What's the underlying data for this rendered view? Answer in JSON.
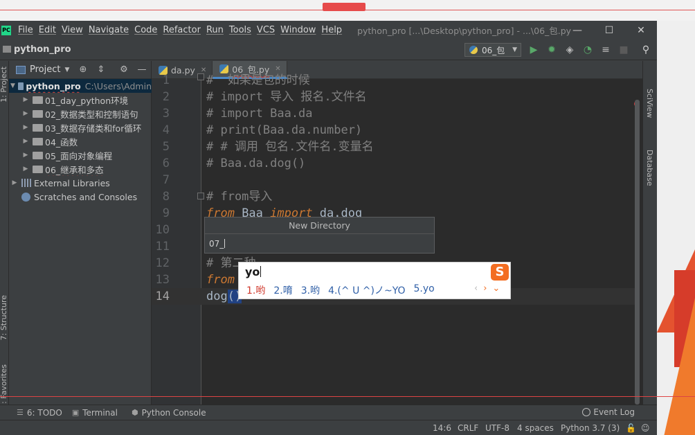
{
  "window": {
    "title": "python_pro [...\\Desktop\\python_pro] - ...\\06_包.py",
    "logo": "PC"
  },
  "menu": [
    "File",
    "Edit",
    "View",
    "Navigate",
    "Code",
    "Refactor",
    "Run",
    "Tools",
    "VCS",
    "Window",
    "Help"
  ],
  "navbar": {
    "project": "python_pro",
    "run_config": "06_包"
  },
  "left_tabs": {
    "project": "1: Project",
    "structure": "7: Structure",
    "favorites": "2: Favorites"
  },
  "right_tabs": {
    "sciview": "SciView",
    "database": "Database"
  },
  "project_panel": {
    "title": "Project",
    "root": {
      "name": "python_pro",
      "path": "C:\\Users\\Admin"
    },
    "folders": [
      "01_day_python环境",
      "02_数据类型和控制语句",
      "03_数据存储类和for循环",
      "04_函数",
      "05_面向对象编程",
      "06_继承和多态"
    ],
    "external_libraries": "External Libraries",
    "scratches": "Scratches and Consoles"
  },
  "tabs": [
    {
      "label": "da.py"
    },
    {
      "label": "06_包.py"
    }
  ],
  "code": [
    {
      "n": "1",
      "text": "#  如果是包的时候"
    },
    {
      "n": "2",
      "text": "# import 导入 报名.文件名"
    },
    {
      "n": "3",
      "text": "# import Baa.da"
    },
    {
      "n": "4",
      "text": "# print(Baa.da.number)"
    },
    {
      "n": "5",
      "text": "# # 调用 包名.文件名.变量名"
    },
    {
      "n": "6",
      "text": "# Baa.da.dog()"
    },
    {
      "n": "7",
      "text": ""
    },
    {
      "n": "8",
      "text": "# from导入"
    },
    {
      "n": "9",
      "kw1": "from",
      "mid1": " Baa ",
      "kw2": "import",
      "rest": " da.dog"
    },
    {
      "n": "10",
      "text": ""
    },
    {
      "n": "11",
      "text": ""
    },
    {
      "n": "12",
      "text": "# 第二种"
    },
    {
      "n": "13",
      "kw1": "from"
    },
    {
      "n": "14",
      "fn": "dog",
      "sel": "()"
    }
  ],
  "new_directory": {
    "title": "New Directory",
    "value": "07_"
  },
  "ime": {
    "composition": "yo",
    "logo": "S",
    "candidates": [
      "1.哟",
      "2.唷",
      "3.哟",
      "4.(^ U ^)ノ~YO",
      "5.yo"
    ],
    "nav": [
      "‹",
      "›",
      "⌄"
    ]
  },
  "bottom_tools": {
    "todo": "6: TODO",
    "terminal": "Terminal",
    "python_console": "Python Console",
    "event_log": "Event Log"
  },
  "status": {
    "position": "14:6",
    "line_sep": "CRLF",
    "encoding": "UTF-8",
    "indent": "4 spaces",
    "interpreter": "Python 3.7 (3)"
  },
  "colors": {
    "accent": "#4a88c7",
    "keyword": "#cc7832",
    "comment": "#808080",
    "error": "#d43b3b",
    "ime_brand": "#f36d21"
  }
}
